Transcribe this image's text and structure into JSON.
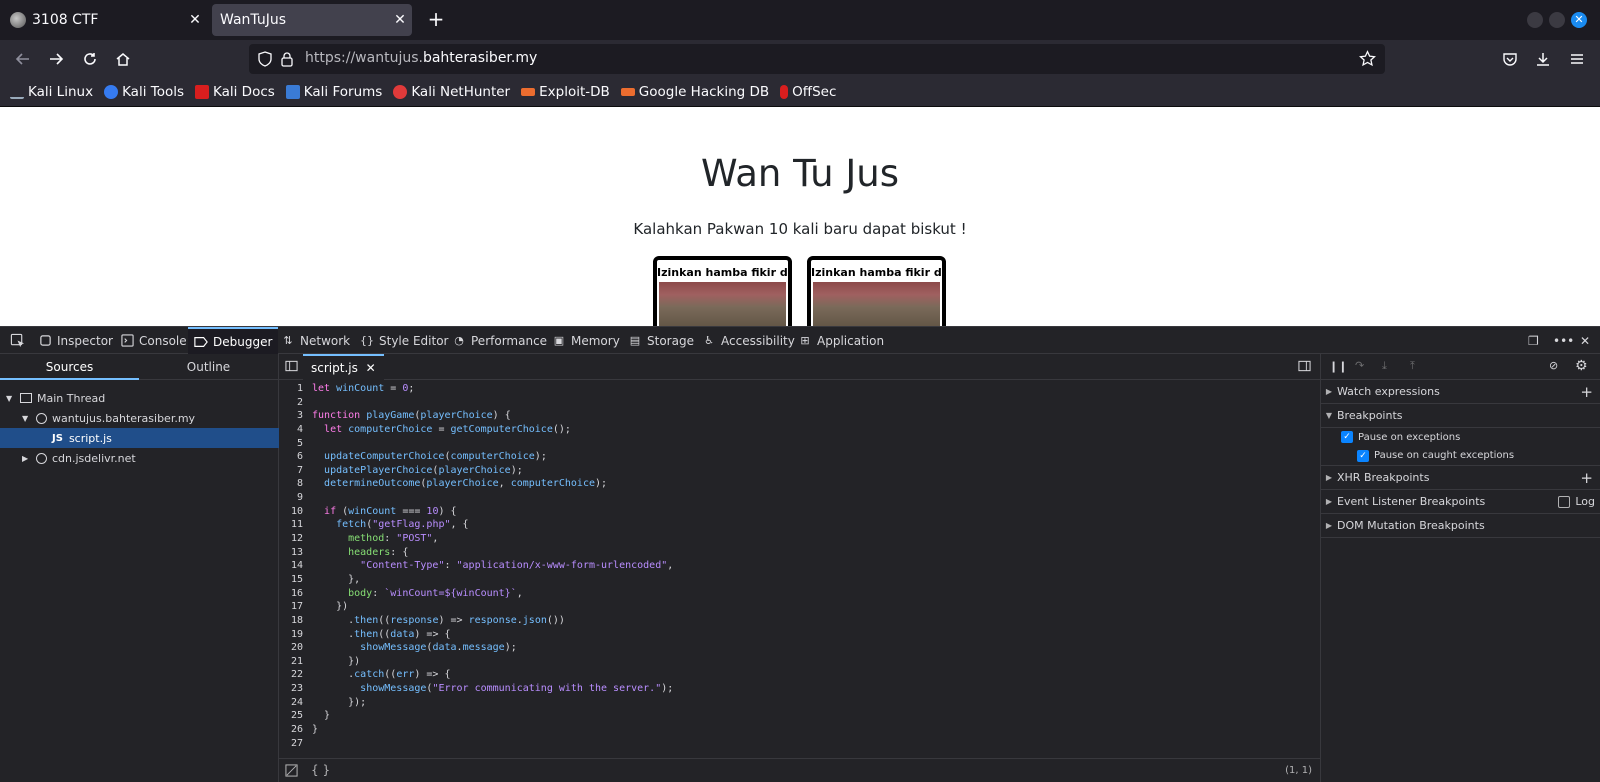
{
  "browser": {
    "tabs": [
      {
        "title": "3108 CTF",
        "active": false
      },
      {
        "title": "WanTuJus",
        "active": true
      }
    ],
    "url_prefix": "https://wantujus.",
    "url_domain": "bahterasiber.my",
    "bookmarks": [
      {
        "label": "Kali Linux",
        "icon": "kali-icon",
        "color": "#367bf0"
      },
      {
        "label": "Kali Tools",
        "icon": "kali-tools-icon",
        "color": "#e03a3a"
      },
      {
        "label": "Kali Docs",
        "icon": "kali-docs-icon",
        "color": "#d81e1e"
      },
      {
        "label": "Kali Forums",
        "icon": "kali-forums-icon",
        "color": "#3a7bd5"
      },
      {
        "label": "Kali NetHunter",
        "icon": "nethunter-icon",
        "color": "#e03a3a"
      },
      {
        "label": "Exploit-DB",
        "icon": "exploit-db-icon",
        "color": "#ec6d2f"
      },
      {
        "label": "Google Hacking DB",
        "icon": "ghdb-icon",
        "color": "#ec6d2f"
      },
      {
        "label": "OffSec",
        "icon": "offsec-icon",
        "color": "#d81e1e"
      }
    ]
  },
  "page": {
    "title": "Wan Tu Jus",
    "subtitle": "Kalahkan Pakwan 10 kali baru dapat biskut !",
    "cards": [
      {
        "caption": "Izinkan hamba fikir dulu"
      },
      {
        "caption": "Izinkan hamba fikir dulu"
      }
    ]
  },
  "devtools": {
    "tabs": [
      {
        "label": "Inspector",
        "icon": "inspector-icon"
      },
      {
        "label": "Console",
        "icon": "console-icon"
      },
      {
        "label": "Debugger",
        "icon": "debugger-icon",
        "active": true
      },
      {
        "label": "Network",
        "icon": "network-icon"
      },
      {
        "label": "Style Editor",
        "icon": "style-editor-icon"
      },
      {
        "label": "Performance",
        "icon": "performance-icon"
      },
      {
        "label": "Memory",
        "icon": "memory-icon"
      },
      {
        "label": "Storage",
        "icon": "storage-icon"
      },
      {
        "label": "Accessibility",
        "icon": "accessibility-icon"
      },
      {
        "label": "Application",
        "icon": "application-icon"
      }
    ],
    "sources": {
      "tab_sources": "Sources",
      "tab_outline": "Outline",
      "tree": [
        {
          "label": "Main Thread",
          "icon": "window-icon"
        },
        {
          "label": "wantujus.bahterasiber.my",
          "icon": "globe-icon"
        },
        {
          "label": "script.js",
          "icon": "js-file-icon",
          "badge": "JS",
          "selected": true
        },
        {
          "label": "cdn.jsdelivr.net",
          "icon": "globe-icon"
        }
      ]
    },
    "editor": {
      "file_tab": "script.js",
      "cursor": "(1, 1)",
      "format_label": "{ }",
      "lines": [
        "let winCount = 0;",
        "",
        "function playGame(playerChoice) {",
        "  let computerChoice = getComputerChoice();",
        "",
        "  updateComputerChoice(computerChoice);",
        "  updatePlayerChoice(playerChoice);",
        "  determineOutcome(playerChoice, computerChoice);",
        "",
        "  if (winCount === 10) {",
        "    fetch(\"getFlag.php\", {",
        "      method: \"POST\",",
        "      headers: {",
        "        \"Content-Type\": \"application/x-www-form-urlencoded\",",
        "      },",
        "      body: `winCount=${winCount}`,",
        "    })",
        "      .then((response) => response.json())",
        "      .then((data) => {",
        "        showMessage(data.message);",
        "      })",
        "      .catch((err) => {",
        "        showMessage(\"Error communicating with the server.\");",
        "      });",
        "  }",
        "}",
        ""
      ]
    },
    "right": {
      "watch": "Watch expressions",
      "breakpoints": "Breakpoints",
      "pause_exceptions": "Pause on exceptions",
      "pause_caught": "Pause on caught exceptions",
      "xhr": "XHR Breakpoints",
      "event_listener": "Event Listener Breakpoints",
      "log": "Log",
      "dom_mutation": "DOM Mutation Breakpoints"
    }
  }
}
